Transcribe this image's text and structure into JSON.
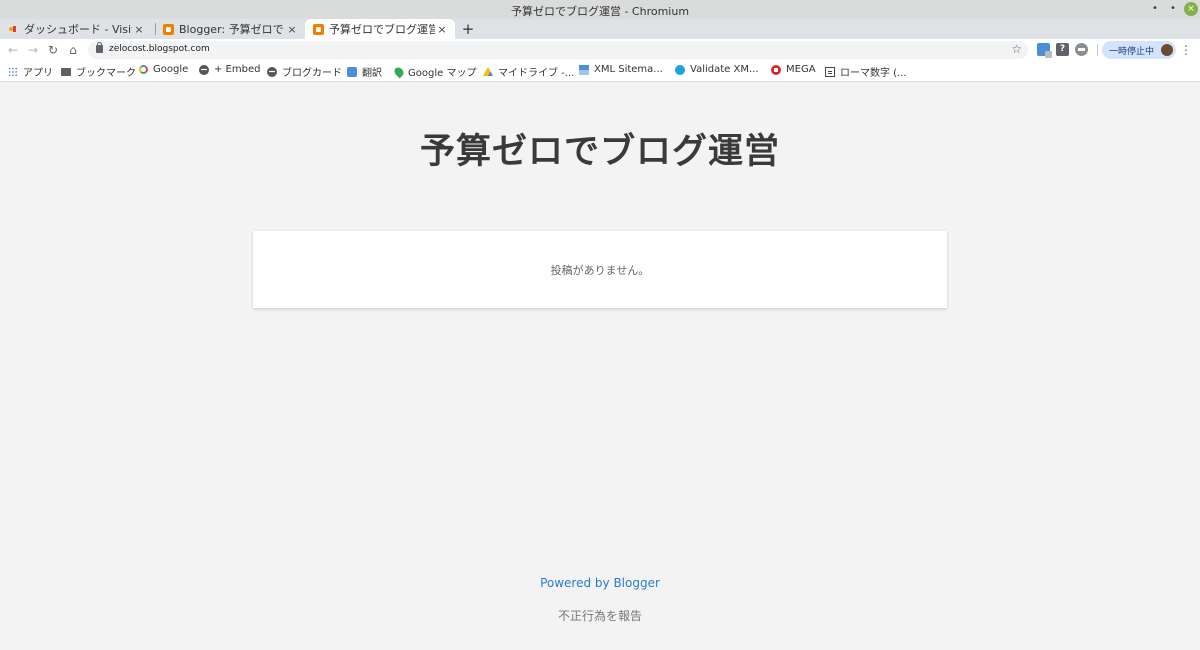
{
  "window": {
    "title": "予算ゼロでブログ運営 - Chromium",
    "controls": {
      "minimize": "•",
      "maximize": "•",
      "close": "×"
    }
  },
  "tabs": [
    {
      "label": "ダッシュボード - Visitors",
      "icon": "dashboard-favicon",
      "active": false
    },
    {
      "label": "Blogger: 予算ゼロでブロ",
      "icon": "blogger-favicon",
      "active": false
    },
    {
      "label": "予算ゼロでブログ運営",
      "icon": "blogger-favicon",
      "active": true
    }
  ],
  "tab_close_glyph": "×",
  "new_tab_glyph": "+",
  "toolbar": {
    "back_glyph": "←",
    "forward_glyph": "→",
    "reload_glyph": "↻",
    "home_glyph": "⌂",
    "url": "zelocost.blogspot.com",
    "bookmark_star": "☆",
    "help_glyph": "?",
    "profile_label": "一時停止中",
    "menu_glyph": "⋮"
  },
  "bookmarks": [
    {
      "label": "アプリ",
      "icon": "apps-icon"
    },
    {
      "label": "ブックマーク",
      "icon": "folder-icon"
    },
    {
      "label": "Google",
      "icon": "google-icon"
    },
    {
      "label": "+ Embed",
      "icon": "globe-icon"
    },
    {
      "label": "ブログカード",
      "icon": "globe-icon"
    },
    {
      "label": "翻訳",
      "icon": "translate-icon"
    },
    {
      "label": "Google マップ",
      "icon": "maps-icon"
    },
    {
      "label": "マイドライブ -...",
      "icon": "drive-icon"
    },
    {
      "label": "XML Sitema...",
      "icon": "sitemap-icon"
    },
    {
      "label": "Validate XM...",
      "icon": "validate-icon"
    },
    {
      "label": "MEGA",
      "icon": "mega-icon"
    },
    {
      "label": "ローマ数字 (...",
      "icon": "clipboard-icon"
    }
  ],
  "blog": {
    "title": "予算ゼロでブログ運営",
    "empty_message": "投稿がありません。",
    "powered_by": "Powered by Blogger",
    "report_abuse": "不正行為を報告"
  },
  "colors": {
    "page_background": "#f3f3f3",
    "title_text": "#3a3a3a",
    "link_blue": "#2b7bca",
    "blogger_orange": "#f57d00"
  }
}
